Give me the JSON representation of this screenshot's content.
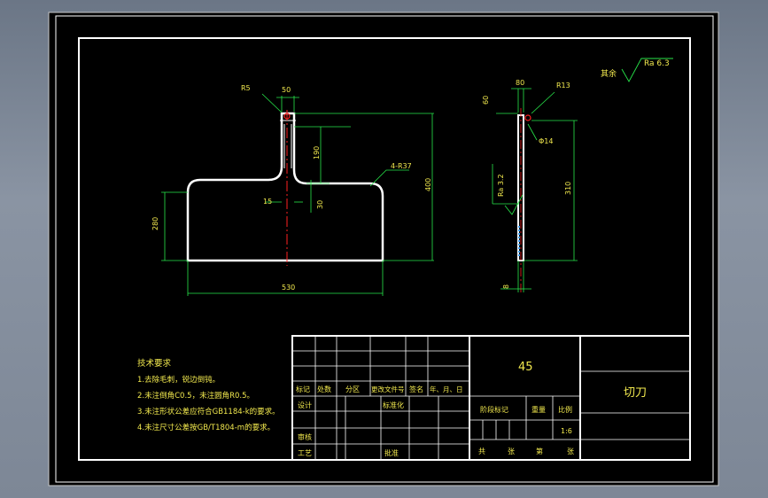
{
  "colors": {
    "background": "#000000",
    "outline": "#ffffff",
    "dimension": "#27e64a",
    "text": "#f2e94e",
    "centerline": "#ff2020"
  },
  "front_view": {
    "dims": {
      "r_top": "R5",
      "top_width": "50",
      "stem_length": "190",
      "total_height": "400",
      "stem_width": "15",
      "fillet_size": "30",
      "blade_height": "280",
      "blade_width": "530",
      "corner_radius": "4-R37"
    }
  },
  "side_view": {
    "dims": {
      "top_left": "60",
      "top_width": "80",
      "r_small": "R13",
      "hole": "Φ14",
      "height": "310",
      "roughness": "Ra 3.2",
      "bottom": "8"
    }
  },
  "roughness_note": {
    "label": "其余",
    "value": "Ra 6.3"
  },
  "requirements": {
    "title": "技术要求",
    "items": [
      "1.去除毛刺，锐边倒钝。",
      "2.未注倒角C0.5，未注圆角R0.5。",
      "3.未注形状公差应符合GB1184-k的要求。",
      "4.未注尺寸公差按GB/T1804-m的要求。"
    ]
  },
  "title_block": {
    "material": "45",
    "part_name": "切刀",
    "headers": [
      "标记",
      "处数",
      "分区",
      "更改文件号",
      "签名",
      "年、月、日"
    ],
    "design": "设计",
    "standardize": "标准化",
    "stage_mark": "阶段标记",
    "weight": "重量",
    "scale_label": "比例",
    "scale_value": "1:6",
    "review": "审核",
    "process": "工艺",
    "approve": "批准",
    "total": "共",
    "sheets": "张",
    "sheet_no": "第",
    "sheet_word": "张"
  }
}
